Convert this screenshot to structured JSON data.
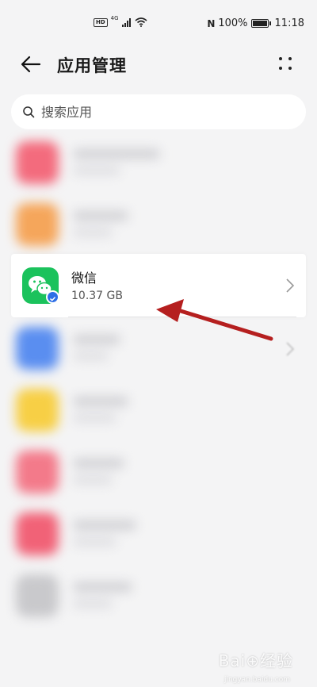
{
  "status_bar": {
    "network_label": "4G",
    "nfc_label": "N",
    "battery_percent": "100%",
    "time": "11:18"
  },
  "header": {
    "title": "应用管理"
  },
  "search": {
    "placeholder": "搜索应用"
  },
  "app_list": {
    "highlighted": {
      "name": "微信",
      "size": "10.37 GB"
    },
    "blurred_rows": [
      {
        "icon_color": "#f36b7d"
      },
      {
        "icon_color": "#f5a65b"
      },
      {
        "icon_color": "#5a8ef0"
      },
      {
        "icon_color": "#f7cf45"
      },
      {
        "icon_color": "#f37a8a"
      },
      {
        "icon_color": "#f16277"
      },
      {
        "icon_color": "#c9c9cc"
      }
    ]
  },
  "annotation": {
    "arrow_color": "#b51f1f"
  },
  "watermark": {
    "brand": "Bai⊕经验",
    "url": "jingyan.baidu.com"
  }
}
